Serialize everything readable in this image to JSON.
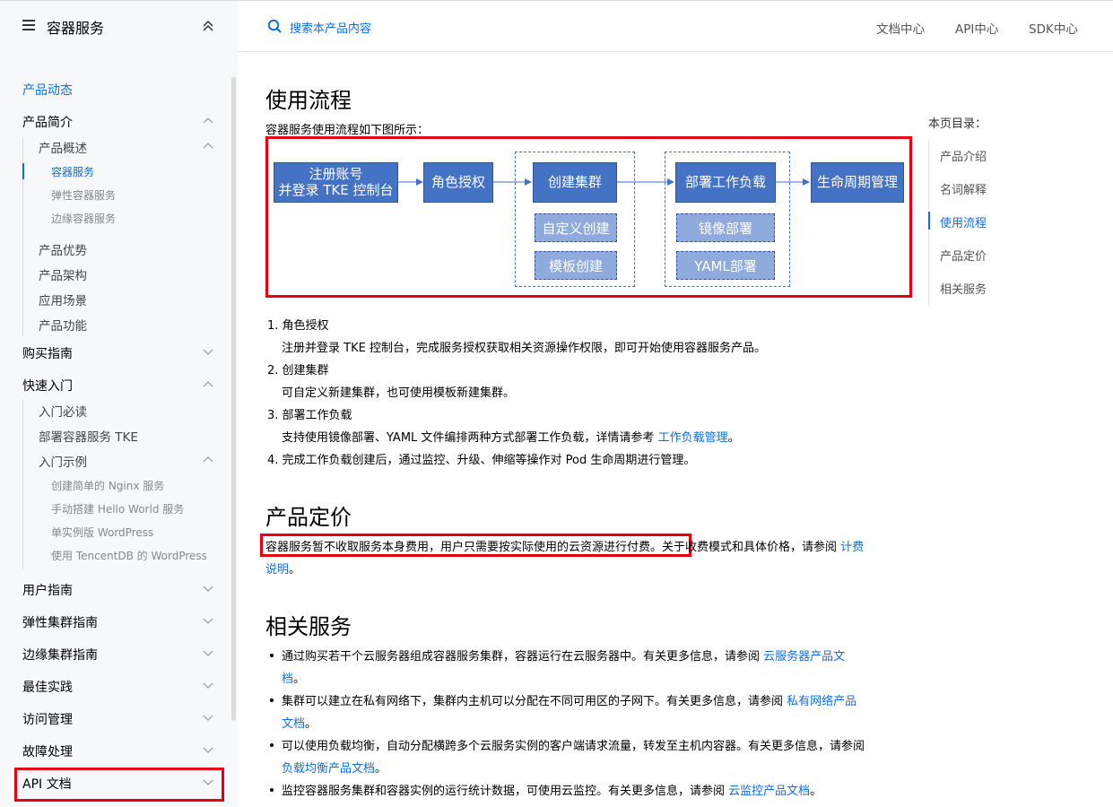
{
  "sidebar": {
    "title": "容器服务",
    "items": [
      {
        "label": "产品动态",
        "active": true
      },
      {
        "label": "产品简介"
      },
      {
        "label": "产品概述"
      },
      {
        "label": "容器服务"
      },
      {
        "label": "弹性容器服务"
      },
      {
        "label": "边缘容器服务"
      },
      {
        "label": "产品优势"
      },
      {
        "label": "产品架构"
      },
      {
        "label": "应用场景"
      },
      {
        "label": "产品功能"
      },
      {
        "label": "购买指南"
      },
      {
        "label": "快速入门"
      },
      {
        "label": "入门必读"
      },
      {
        "label": "部署容器服务 TKE"
      },
      {
        "label": "入门示例"
      },
      {
        "label": "创建简单的 Nginx 服务"
      },
      {
        "label": "手动搭建 Hello World 服务"
      },
      {
        "label": "单实例版 WordPress"
      },
      {
        "label": "使用 TencentDB 的 WordPress"
      },
      {
        "label": "用户指南"
      },
      {
        "label": "弹性集群指南"
      },
      {
        "label": "边缘集群指南"
      },
      {
        "label": "最佳实践"
      },
      {
        "label": "访问管理"
      },
      {
        "label": "故障处理"
      },
      {
        "label": "API 文档"
      }
    ]
  },
  "topbar": {
    "search_label": "搜索本产品内容",
    "links": [
      "文档中心",
      "API中心",
      "SDK中心"
    ]
  },
  "content": {
    "section1_title": "使用流程",
    "section1_intro": "容器服务使用流程如下图所示：",
    "flow": {
      "step1_line1": "注册账号",
      "step1_line2": "并登录 TKE 控制台",
      "step2": "角色授权",
      "step3": "创建集群",
      "step3_sub1": "自定义创建",
      "step3_sub2": "模板创建",
      "step4": "部署工作负载",
      "step4_sub1": "镜像部署",
      "step4_sub2": "YAML部署",
      "step5": "生命周期管理"
    },
    "steps": [
      {
        "title": "1. 角色授权",
        "desc": "注册并登录 TKE 控制台，完成服务授权获取相关资源操作权限，即可开始使用容器服务产品。"
      },
      {
        "title": "2. 创建集群",
        "desc": "可自定义新建集群，也可使用模板新建集群。"
      },
      {
        "title": "3. 部署工作负载",
        "desc": "支持使用镜像部署、YAML 文件编排两种方式部署工作负载，详情请参考 ",
        "link": "工作负载管理",
        "tail": "。"
      },
      {
        "title": "4. 完成工作负载创建后，通过监控、升级、伸缩等操作对 Pod 生命周期进行管理。"
      }
    ],
    "section2_title": "产品定价",
    "pricing_highlight": "容器服务暂不收取服务本身费用，用户只需要按实际使用的云资源进行付费。",
    "pricing_rest": "关于收费模式和具体价格，请参阅 ",
    "pricing_link1": "计费",
    "pricing_link2": "说明",
    "pricing_tail": "。",
    "section3_title": "相关服务",
    "services": [
      {
        "text": "通过购买若干个云服务器组成容器服务集群，容器运行在云服务器中。有关更多信息，请参阅 ",
        "link1": "云服务器产品文",
        "link2": "档",
        "tail": "。"
      },
      {
        "text": "集群可以建立在私有网络下，集群内主机可以分配在不同可用区的子网下。有关更多信息，请参阅 ",
        "link1": "私有网络产品",
        "link2": "文档",
        "tail": "。"
      },
      {
        "text": "可以使用负载均衡，自动分配横跨多个云服务实例的客户端请求流量，转发至主机内容器。有关更多信息，请参阅",
        "link2": "负载均衡产品文档",
        "tail": "。"
      },
      {
        "text": "监控容器服务集群和容器实例的运行统计数据，可使用云监控。有关更多信息，请参阅 ",
        "link1": "云监控产品文档",
        "tail": "。"
      }
    ]
  },
  "toc": {
    "title": "本页目录：",
    "items": [
      "产品介绍",
      "名词解释",
      "使用流程",
      "产品定价",
      "相关服务"
    ],
    "active_index": 2
  },
  "colors": {
    "accent": "#0f6fe0",
    "highlight_border": "#e60012",
    "flow_box": "#4472c4",
    "flow_box_light": "#8faadc"
  }
}
